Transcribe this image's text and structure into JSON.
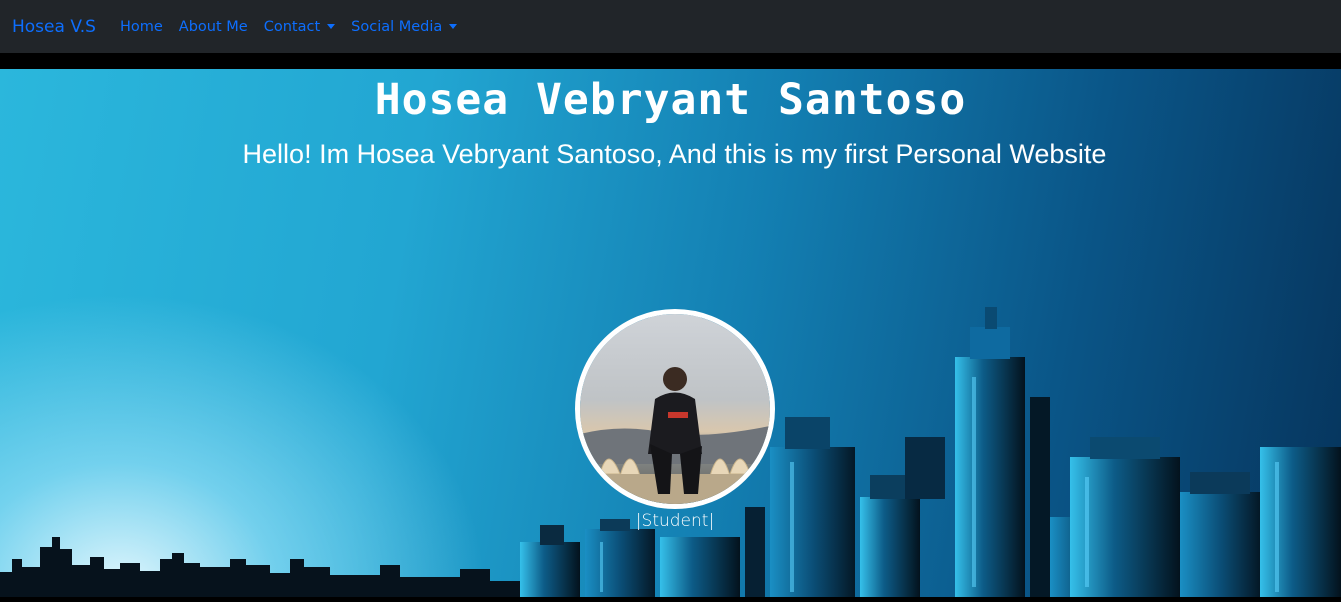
{
  "navbar": {
    "brand": "Hosea V.S",
    "items": [
      {
        "label": "Home",
        "dropdown": false
      },
      {
        "label": "About Me",
        "dropdown": false
      },
      {
        "label": "Contact",
        "dropdown": true
      },
      {
        "label": "Social Media",
        "dropdown": true
      }
    ]
  },
  "hero": {
    "title": "Hosea Vebryant Santoso",
    "subtitle": "Hello! Im Hosea Vebryant Santoso, And this is my first Personal Website",
    "role": "|Student|"
  },
  "colors": {
    "navbar_bg": "#212529",
    "link": "#0d6efd",
    "text": "#ffffff"
  }
}
